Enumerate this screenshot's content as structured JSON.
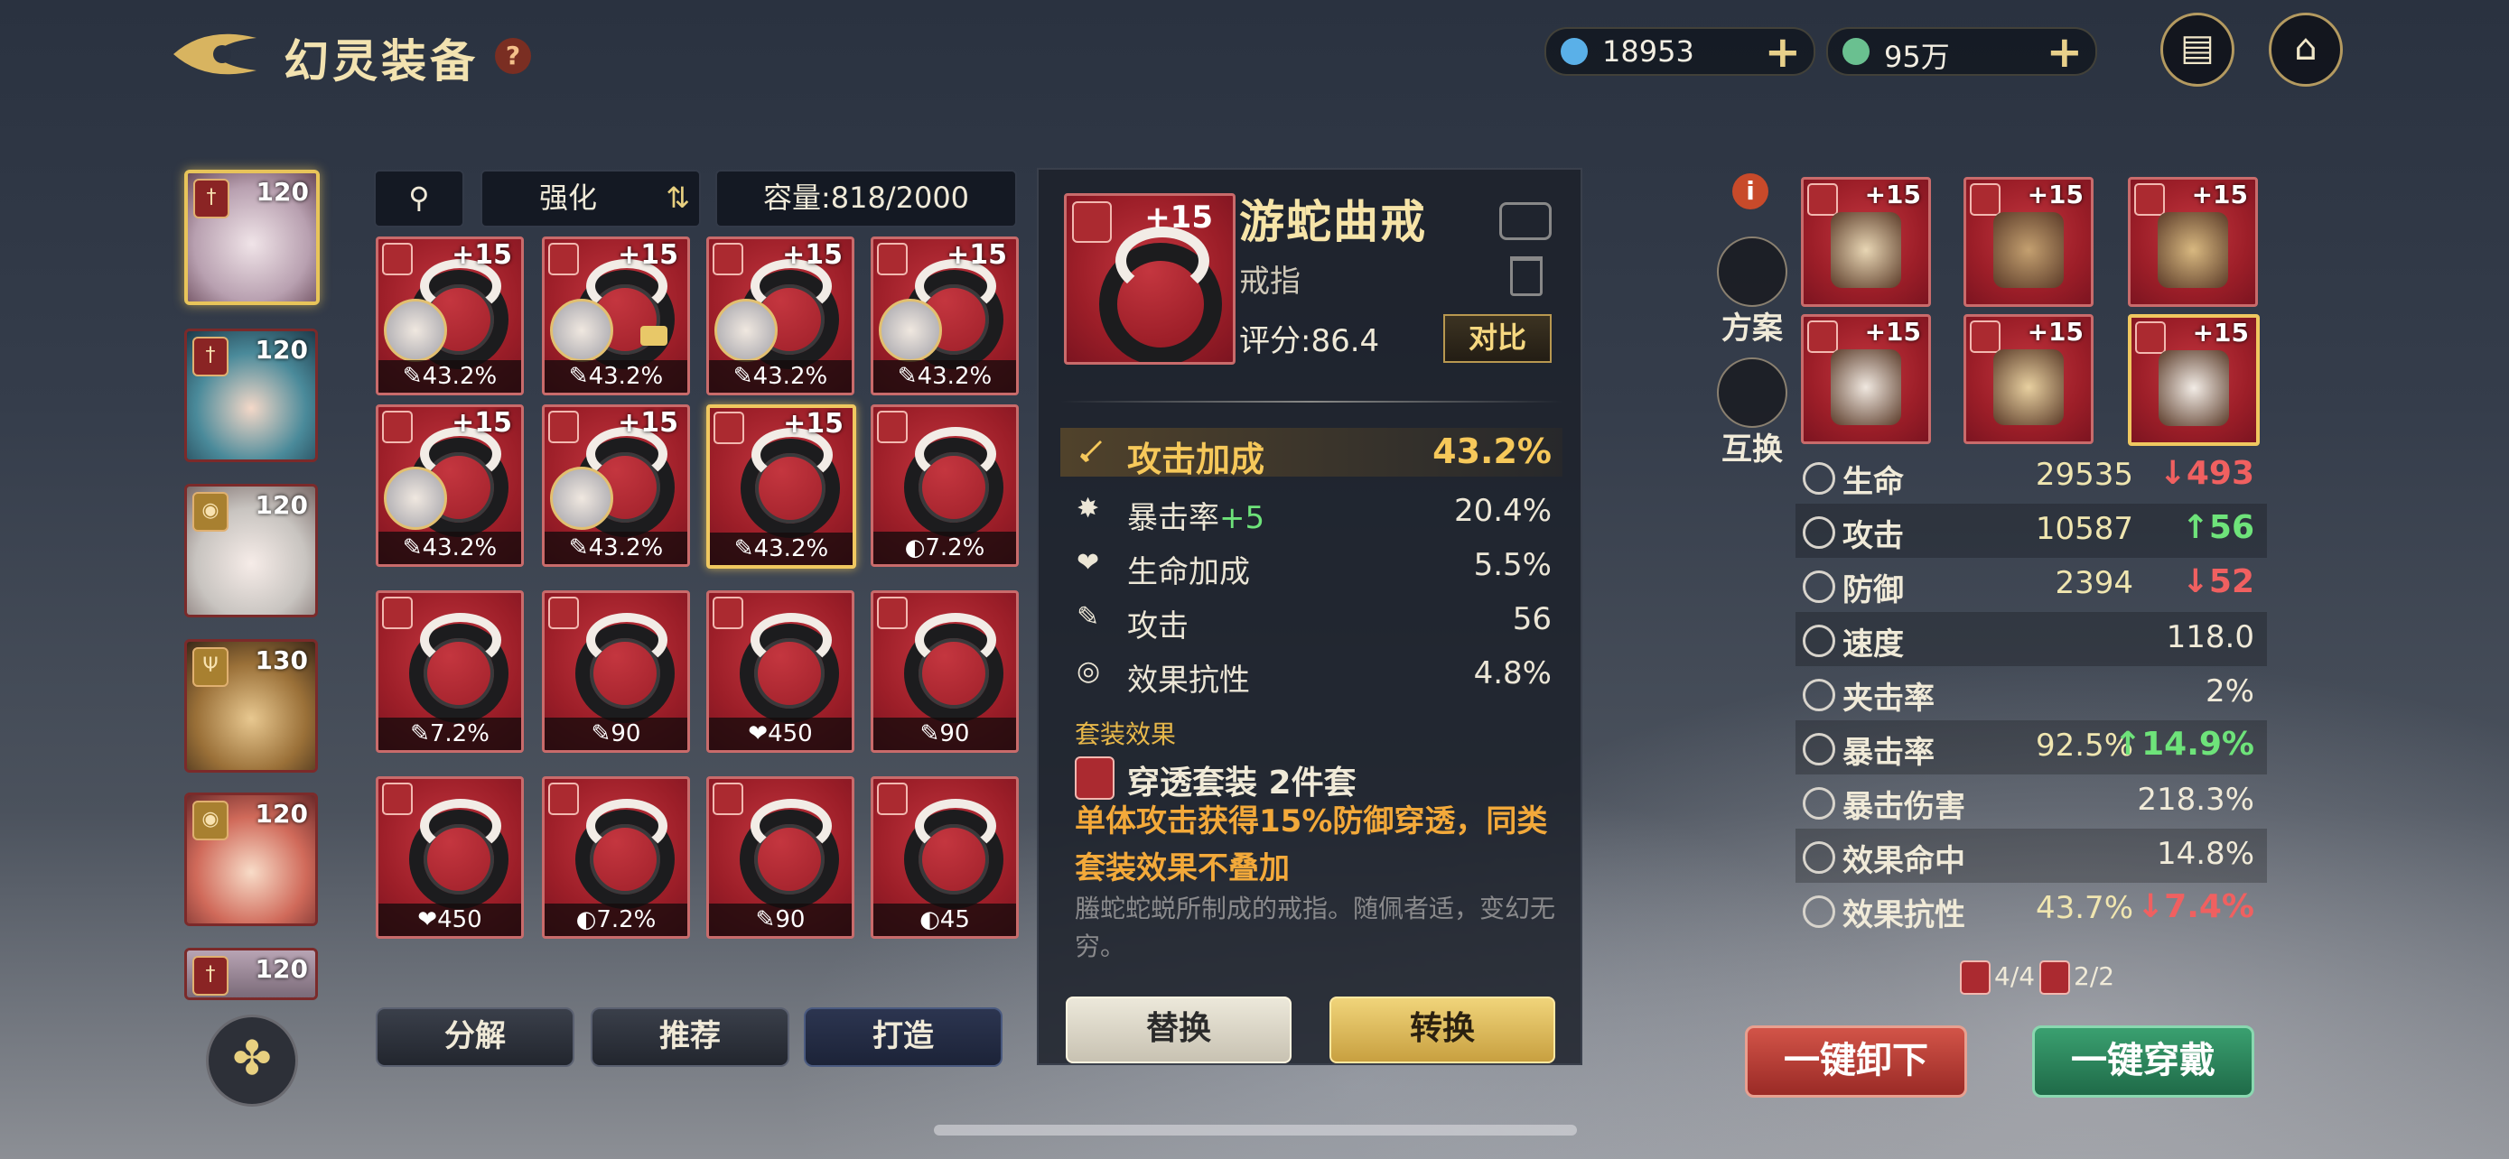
{
  "header": {
    "title": "幻灵装备",
    "help": "?",
    "currency1": {
      "value": "18953",
      "icon": "spirit-crystal-icon",
      "plus": "+"
    },
    "currency2": {
      "value": "95万",
      "icon": "coin-icon",
      "plus": "+"
    },
    "chat_icon": "chat-icon",
    "home_icon": "pavilion-icon"
  },
  "heroes": [
    {
      "level": "120",
      "emblem": "†",
      "selected": true
    },
    {
      "level": "120",
      "emblem": "†"
    },
    {
      "level": "120",
      "emblem": "◉"
    },
    {
      "level": "130",
      "emblem": "Ψ"
    },
    {
      "level": "120",
      "emblem": "◉"
    },
    {
      "level": "120",
      "emblem": "†"
    }
  ],
  "toolbar": {
    "filter_icon": "filter-icon",
    "sort_label": "强化",
    "sort_icon": "sort-toggle-icon",
    "capacity": "容量:818/2000"
  },
  "items": [
    {
      "plus": "+15",
      "stat": "43.2%",
      "stat_icon": "sword",
      "avatar": true
    },
    {
      "plus": "+15",
      "stat": "43.2%",
      "stat_icon": "sword",
      "avatar": true,
      "lock": true
    },
    {
      "plus": "+15",
      "stat": "43.2%",
      "stat_icon": "sword",
      "avatar": true
    },
    {
      "plus": "+15",
      "stat": "43.2%",
      "stat_icon": "sword",
      "avatar": true
    },
    {
      "plus": "+15",
      "stat": "43.2%",
      "stat_icon": "sword",
      "avatar": true
    },
    {
      "plus": "+15",
      "stat": "43.2%",
      "stat_icon": "sword",
      "avatar": true
    },
    {
      "plus": "+15",
      "stat": "43.2%",
      "stat_icon": "sword",
      "selected": true
    },
    {
      "plus": "",
      "stat": "7.2%",
      "stat_icon": "shield"
    },
    {
      "plus": "",
      "stat": "7.2%",
      "stat_icon": "sword"
    },
    {
      "plus": "",
      "stat": "90",
      "stat_icon": "sword"
    },
    {
      "plus": "",
      "stat": "450",
      "stat_icon": "heart"
    },
    {
      "plus": "",
      "stat": "90",
      "stat_icon": "sword"
    },
    {
      "plus": "",
      "stat": "450",
      "stat_icon": "heart"
    },
    {
      "plus": "",
      "stat": "7.2%",
      "stat_icon": "shield"
    },
    {
      "plus": "",
      "stat": "90",
      "stat_icon": "sword"
    },
    {
      "plus": "",
      "stat": "45",
      "stat_icon": "shield"
    }
  ],
  "bottom_buttons": {
    "decompose": "分解",
    "recommend": "推荐",
    "forge": "打造"
  },
  "detail": {
    "plus": "+15",
    "name": "游蛇曲戒",
    "type": "戒指",
    "score": "评分:86.4",
    "compare": "对比",
    "main_stat": {
      "label": "攻击加成",
      "value": "43.2%"
    },
    "sub_stats": [
      {
        "label": "暴击率",
        "bonus": "+5",
        "value": "20.4%",
        "icon": "crit-icon"
      },
      {
        "label": "生命加成",
        "bonus": "",
        "value": "5.5%",
        "icon": "heart-icon"
      },
      {
        "label": "攻击",
        "bonus": "",
        "value": "56",
        "icon": "sword-icon"
      },
      {
        "label": "效果抗性",
        "bonus": "",
        "value": "4.8%",
        "icon": "resist-icon"
      }
    ],
    "set_label": "套装效果",
    "set_name": "穿透套装  2件套",
    "set_desc": "单体攻击获得15%防御穿透，同类套装效果不叠加",
    "flavor": "螣蛇蛇蜕所制成的戒指。随佩者适，变幻无穷。",
    "replace": "替换",
    "transform": "转换"
  },
  "side": {
    "info": "i",
    "plan": "方案",
    "swap": "互换"
  },
  "equipped": [
    {
      "plus": "+15"
    },
    {
      "plus": "+15"
    },
    {
      "plus": "+15"
    },
    {
      "plus": "+15"
    },
    {
      "plus": "+15"
    },
    {
      "plus": "+15",
      "selected": true
    }
  ],
  "char_stats": [
    {
      "label": "生命",
      "base": "29535",
      "diff": "493",
      "dir": "down",
      "icon": "heart-icon"
    },
    {
      "label": "攻击",
      "base": "10587",
      "diff": "56",
      "dir": "up",
      "icon": "sword-icon"
    },
    {
      "label": "防御",
      "base": "2394",
      "diff": "52",
      "dir": "down",
      "icon": "shield-icon"
    },
    {
      "label": "速度",
      "value": "118.0",
      "icon": "speed-icon"
    },
    {
      "label": "夹击率",
      "value": "2%",
      "icon": "pincer-icon"
    },
    {
      "label": "暴击率",
      "base": "92.5%",
      "diff": "14.9%",
      "dir": "up",
      "icon": "crit-icon"
    },
    {
      "label": "暴击伤害",
      "value": "218.3%",
      "icon": "crit-damage-icon"
    },
    {
      "label": "效果命中",
      "value": "14.8%",
      "icon": "hit-icon"
    },
    {
      "label": "效果抗性",
      "base": "43.7%",
      "diff": "7.4%",
      "dir": "down",
      "icon": "resist-icon"
    }
  ],
  "set_counts": [
    "4/4",
    "2/2"
  ],
  "actions": {
    "unequip_all": "一键卸下",
    "equip_all": "一键穿戴"
  },
  "colors": {
    "up": "#6ee37a",
    "down": "#f06060",
    "gold": "#f6c85a",
    "card_red": "#9c1e28"
  }
}
